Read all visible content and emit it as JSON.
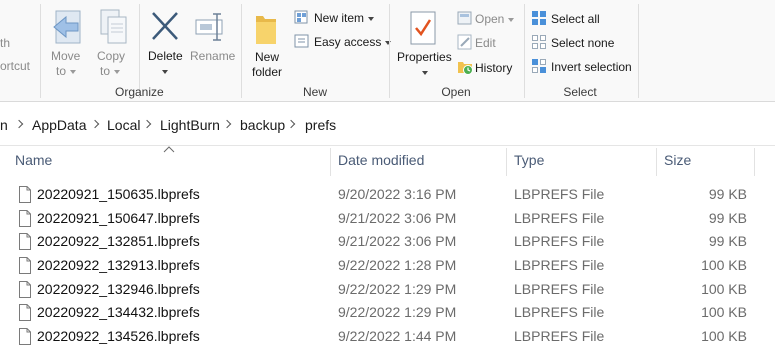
{
  "ribbon": {
    "clipboard_partial": {
      "line1": "th",
      "line2": "ortcut"
    },
    "organize": {
      "move_to": {
        "line1": "Move",
        "line2": "to"
      },
      "copy_to": {
        "line1": "Copy",
        "line2": "to"
      },
      "delete": "Delete",
      "rename": "Rename",
      "group_label": "Organize"
    },
    "new": {
      "new_folder": {
        "line1": "New",
        "line2": "folder"
      },
      "new_item": "New item",
      "easy_access": "Easy access",
      "group_label": "New"
    },
    "open": {
      "properties": "Properties",
      "open": "Open",
      "edit": "Edit",
      "history": "History",
      "group_label": "Open"
    },
    "select": {
      "select_all": "Select all",
      "select_none": "Select none",
      "invert_selection": "Invert selection",
      "group_label": "Select"
    }
  },
  "breadcrumb": [
    "n",
    "AppData",
    "Local",
    "LightBurn",
    "backup",
    "prefs"
  ],
  "columns": {
    "name": "Name",
    "date": "Date modified",
    "type": "Type",
    "size": "Size"
  },
  "files": [
    {
      "name": "20220921_150635.lbprefs",
      "date": "9/20/2022 3:16 PM",
      "type": "LBPREFS File",
      "size": "99 KB"
    },
    {
      "name": "20220921_150647.lbprefs",
      "date": "9/21/2022 3:06 PM",
      "type": "LBPREFS File",
      "size": "99 KB"
    },
    {
      "name": "20220922_132851.lbprefs",
      "date": "9/21/2022 3:06 PM",
      "type": "LBPREFS File",
      "size": "99 KB"
    },
    {
      "name": "20220922_132913.lbprefs",
      "date": "9/22/2022 1:28 PM",
      "type": "LBPREFS File",
      "size": "100 KB"
    },
    {
      "name": "20220922_132946.lbprefs",
      "date": "9/22/2022 1:29 PM",
      "type": "LBPREFS File",
      "size": "100 KB"
    },
    {
      "name": "20220922_134432.lbprefs",
      "date": "9/22/2022 1:29 PM",
      "type": "LBPREFS File",
      "size": "100 KB"
    },
    {
      "name": "20220922_134526.lbprefs",
      "date": "9/22/2022 1:44 PM",
      "type": "LBPREFS File",
      "size": "100 KB"
    }
  ],
  "colors": {
    "accent": "#0078d7",
    "header_text": "#4a5b76",
    "ribbon_bg": "#f9f9f9"
  }
}
